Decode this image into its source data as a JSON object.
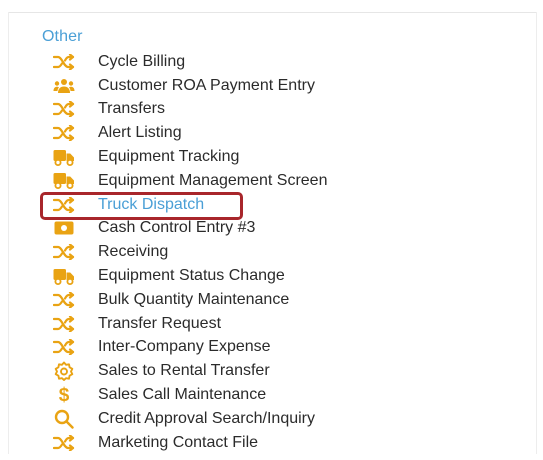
{
  "section": {
    "title": "Other"
  },
  "colors": {
    "icon": "#e9a313",
    "link_blue": "#4a9fd6",
    "highlight_border": "#a8262b",
    "text": "#2b2b2b"
  },
  "menu": {
    "items": [
      {
        "label": "Cycle Billing",
        "icon": "shuffle-icon"
      },
      {
        "label": "Customer ROA Payment Entry",
        "icon": "users-icon"
      },
      {
        "label": "Transfers",
        "icon": "shuffle-icon"
      },
      {
        "label": "Alert Listing",
        "icon": "shuffle-icon"
      },
      {
        "label": "Equipment Tracking",
        "icon": "truck-icon"
      },
      {
        "label": "Equipment Management Screen",
        "icon": "truck-icon"
      },
      {
        "label": "Truck Dispatch",
        "icon": "shuffle-icon",
        "selected": true
      },
      {
        "label": "Cash Control Entry #3",
        "icon": "money-icon"
      },
      {
        "label": "Receiving",
        "icon": "shuffle-icon"
      },
      {
        "label": "Equipment Status Change",
        "icon": "truck-icon"
      },
      {
        "label": "Bulk Quantity Maintenance",
        "icon": "shuffle-icon"
      },
      {
        "label": "Transfer Request",
        "icon": "shuffle-icon"
      },
      {
        "label": "Inter-Company Expense",
        "icon": "shuffle-icon"
      },
      {
        "label": "Sales to Rental Transfer",
        "icon": "gear-icon"
      },
      {
        "label": "Sales Call Maintenance",
        "icon": "dollar-icon"
      },
      {
        "label": "Credit Approval Search/Inquiry",
        "icon": "search-icon"
      },
      {
        "label": "Marketing Contact File",
        "icon": "shuffle-icon"
      }
    ]
  }
}
